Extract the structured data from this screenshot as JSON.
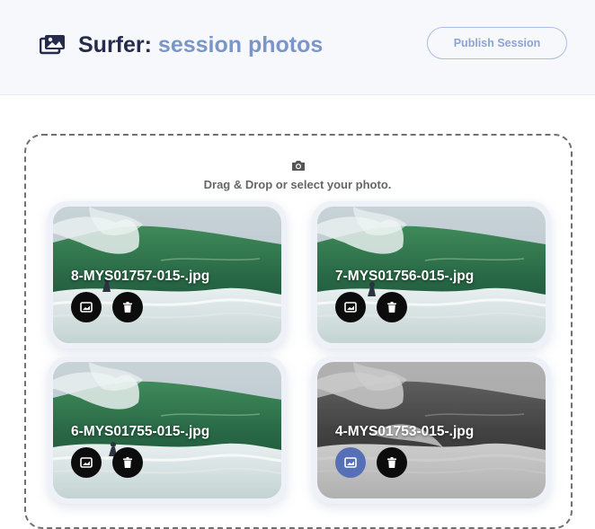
{
  "header": {
    "title_prefix": "Surfer:",
    "title_accent": "session photos",
    "icon": "photo-gallery-icon",
    "publish_label": "Publish Session"
  },
  "dropzone": {
    "icon": "camera-icon",
    "text": "Drag & Drop or select your photo."
  },
  "photos": [
    {
      "filename": "8-MYS01757-015-.jpg",
      "grayscale": false,
      "selected": false
    },
    {
      "filename": "7-MYS01756-015-.jpg",
      "grayscale": false,
      "selected": false
    },
    {
      "filename": "6-MYS01755-015-.jpg",
      "grayscale": false,
      "selected": false
    },
    {
      "filename": "4-MYS01753-015-.jpg",
      "grayscale": true,
      "selected": true
    }
  ],
  "icons": {
    "set_cover": "image-icon",
    "delete": "trash-icon"
  },
  "colors": {
    "title": "#262b4d",
    "accent": "#7a96c9",
    "active_button": "#5670b8"
  }
}
